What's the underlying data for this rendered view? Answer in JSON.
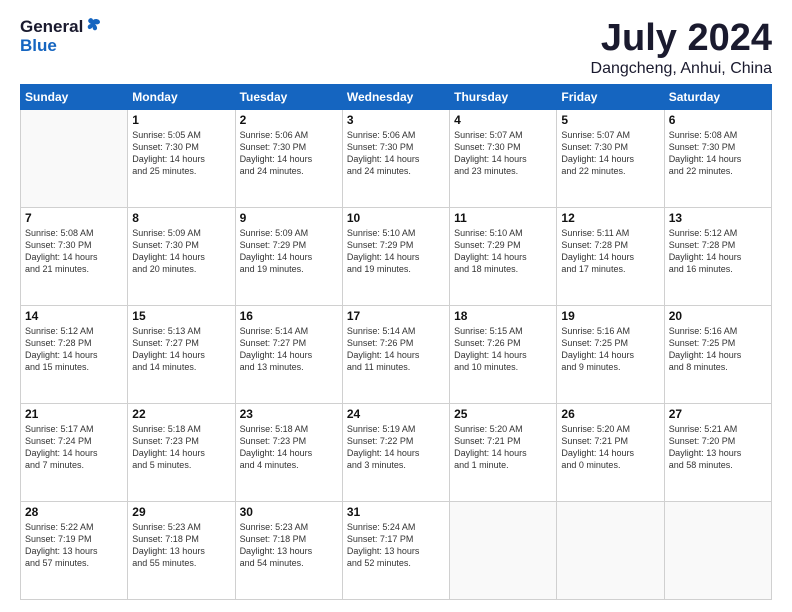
{
  "header": {
    "logo_line1": "General",
    "logo_line2": "Blue",
    "title": "July 2024",
    "location": "Dangcheng, Anhui, China"
  },
  "calendar": {
    "days_of_week": [
      "Sunday",
      "Monday",
      "Tuesday",
      "Wednesday",
      "Thursday",
      "Friday",
      "Saturday"
    ],
    "weeks": [
      [
        {
          "day": "",
          "info": ""
        },
        {
          "day": "1",
          "info": "Sunrise: 5:05 AM\nSunset: 7:30 PM\nDaylight: 14 hours\nand 25 minutes."
        },
        {
          "day": "2",
          "info": "Sunrise: 5:06 AM\nSunset: 7:30 PM\nDaylight: 14 hours\nand 24 minutes."
        },
        {
          "day": "3",
          "info": "Sunrise: 5:06 AM\nSunset: 7:30 PM\nDaylight: 14 hours\nand 24 minutes."
        },
        {
          "day": "4",
          "info": "Sunrise: 5:07 AM\nSunset: 7:30 PM\nDaylight: 14 hours\nand 23 minutes."
        },
        {
          "day": "5",
          "info": "Sunrise: 5:07 AM\nSunset: 7:30 PM\nDaylight: 14 hours\nand 22 minutes."
        },
        {
          "day": "6",
          "info": "Sunrise: 5:08 AM\nSunset: 7:30 PM\nDaylight: 14 hours\nand 22 minutes."
        }
      ],
      [
        {
          "day": "7",
          "info": "Sunrise: 5:08 AM\nSunset: 7:30 PM\nDaylight: 14 hours\nand 21 minutes."
        },
        {
          "day": "8",
          "info": "Sunrise: 5:09 AM\nSunset: 7:30 PM\nDaylight: 14 hours\nand 20 minutes."
        },
        {
          "day": "9",
          "info": "Sunrise: 5:09 AM\nSunset: 7:29 PM\nDaylight: 14 hours\nand 19 minutes."
        },
        {
          "day": "10",
          "info": "Sunrise: 5:10 AM\nSunset: 7:29 PM\nDaylight: 14 hours\nand 19 minutes."
        },
        {
          "day": "11",
          "info": "Sunrise: 5:10 AM\nSunset: 7:29 PM\nDaylight: 14 hours\nand 18 minutes."
        },
        {
          "day": "12",
          "info": "Sunrise: 5:11 AM\nSunset: 7:28 PM\nDaylight: 14 hours\nand 17 minutes."
        },
        {
          "day": "13",
          "info": "Sunrise: 5:12 AM\nSunset: 7:28 PM\nDaylight: 14 hours\nand 16 minutes."
        }
      ],
      [
        {
          "day": "14",
          "info": "Sunrise: 5:12 AM\nSunset: 7:28 PM\nDaylight: 14 hours\nand 15 minutes."
        },
        {
          "day": "15",
          "info": "Sunrise: 5:13 AM\nSunset: 7:27 PM\nDaylight: 14 hours\nand 14 minutes."
        },
        {
          "day": "16",
          "info": "Sunrise: 5:14 AM\nSunset: 7:27 PM\nDaylight: 14 hours\nand 13 minutes."
        },
        {
          "day": "17",
          "info": "Sunrise: 5:14 AM\nSunset: 7:26 PM\nDaylight: 14 hours\nand 11 minutes."
        },
        {
          "day": "18",
          "info": "Sunrise: 5:15 AM\nSunset: 7:26 PM\nDaylight: 14 hours\nand 10 minutes."
        },
        {
          "day": "19",
          "info": "Sunrise: 5:16 AM\nSunset: 7:25 PM\nDaylight: 14 hours\nand 9 minutes."
        },
        {
          "day": "20",
          "info": "Sunrise: 5:16 AM\nSunset: 7:25 PM\nDaylight: 14 hours\nand 8 minutes."
        }
      ],
      [
        {
          "day": "21",
          "info": "Sunrise: 5:17 AM\nSunset: 7:24 PM\nDaylight: 14 hours\nand 7 minutes."
        },
        {
          "day": "22",
          "info": "Sunrise: 5:18 AM\nSunset: 7:23 PM\nDaylight: 14 hours\nand 5 minutes."
        },
        {
          "day": "23",
          "info": "Sunrise: 5:18 AM\nSunset: 7:23 PM\nDaylight: 14 hours\nand 4 minutes."
        },
        {
          "day": "24",
          "info": "Sunrise: 5:19 AM\nSunset: 7:22 PM\nDaylight: 14 hours\nand 3 minutes."
        },
        {
          "day": "25",
          "info": "Sunrise: 5:20 AM\nSunset: 7:21 PM\nDaylight: 14 hours\nand 1 minute."
        },
        {
          "day": "26",
          "info": "Sunrise: 5:20 AM\nSunset: 7:21 PM\nDaylight: 14 hours\nand 0 minutes."
        },
        {
          "day": "27",
          "info": "Sunrise: 5:21 AM\nSunset: 7:20 PM\nDaylight: 13 hours\nand 58 minutes."
        }
      ],
      [
        {
          "day": "28",
          "info": "Sunrise: 5:22 AM\nSunset: 7:19 PM\nDaylight: 13 hours\nand 57 minutes."
        },
        {
          "day": "29",
          "info": "Sunrise: 5:23 AM\nSunset: 7:18 PM\nDaylight: 13 hours\nand 55 minutes."
        },
        {
          "day": "30",
          "info": "Sunrise: 5:23 AM\nSunset: 7:18 PM\nDaylight: 13 hours\nand 54 minutes."
        },
        {
          "day": "31",
          "info": "Sunrise: 5:24 AM\nSunset: 7:17 PM\nDaylight: 13 hours\nand 52 minutes."
        },
        {
          "day": "",
          "info": ""
        },
        {
          "day": "",
          "info": ""
        },
        {
          "day": "",
          "info": ""
        }
      ]
    ]
  }
}
